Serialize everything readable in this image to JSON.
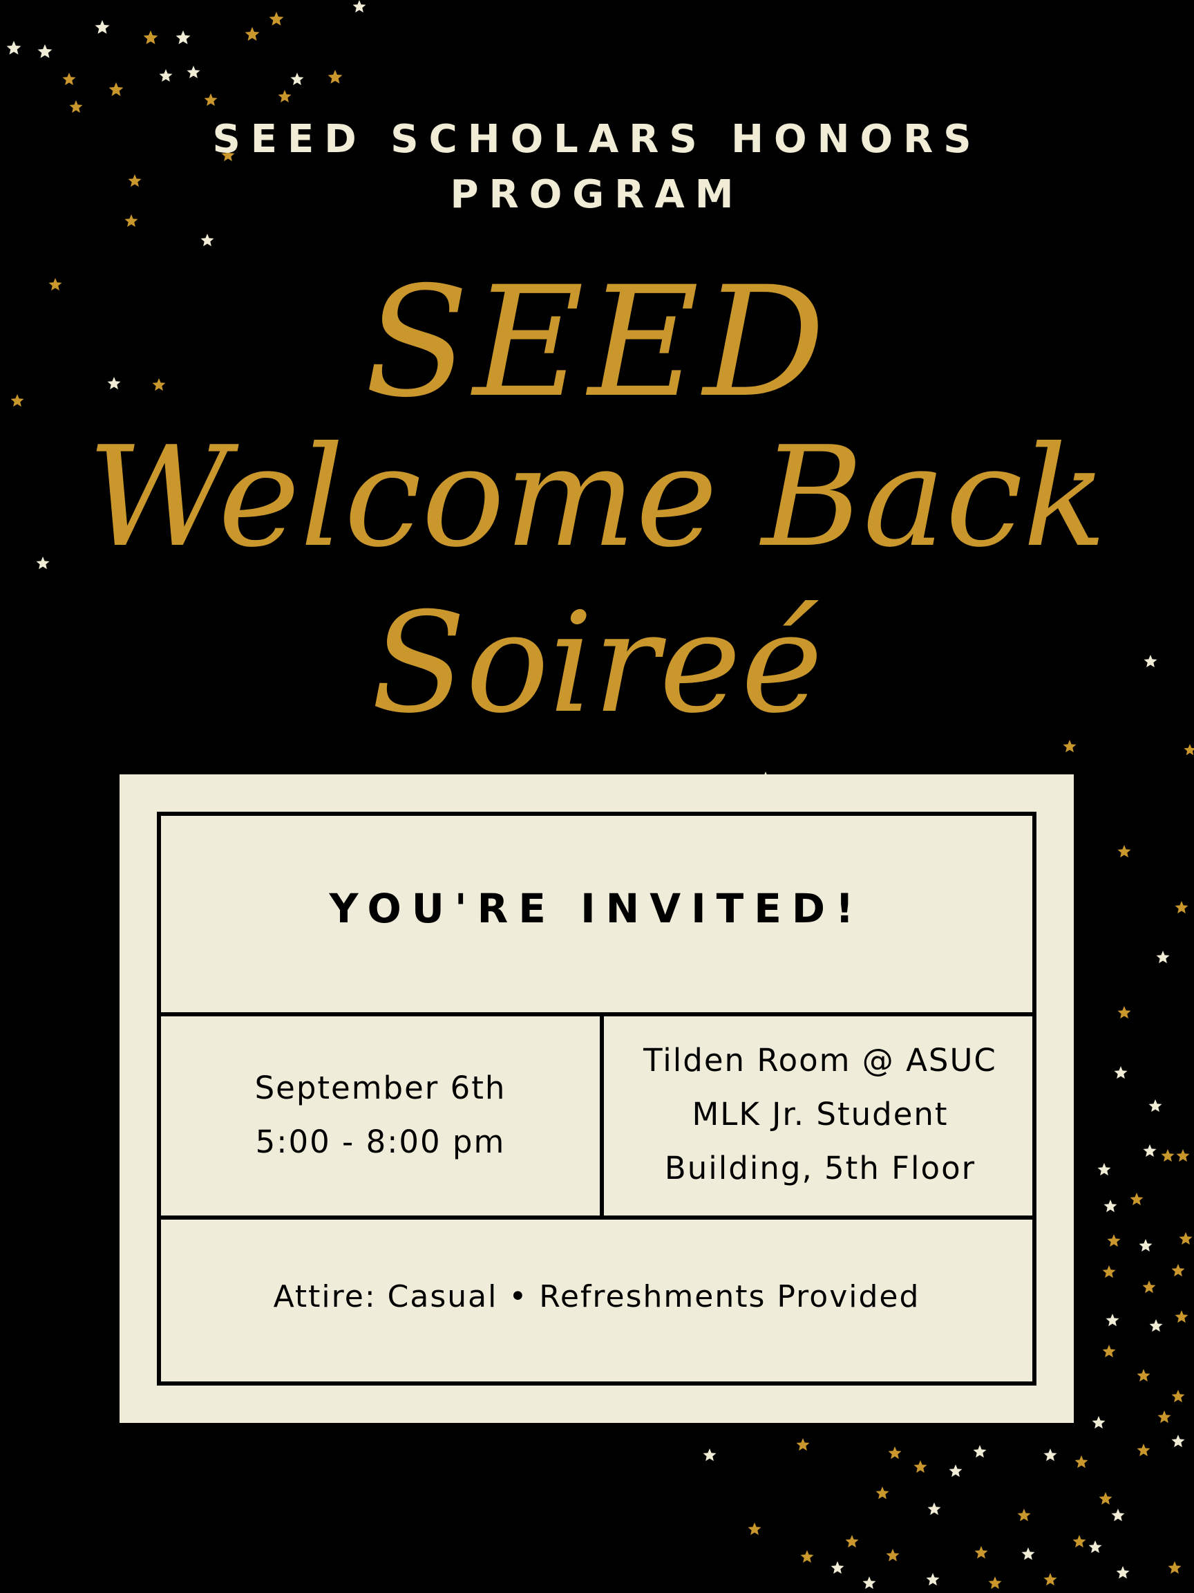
{
  "header": {
    "org_line1": "SEED SCHOLARS HONORS",
    "org_line2": "PROGRAM"
  },
  "title": {
    "line1": "SEED",
    "line2": "Welcome Back",
    "line3": "Soireé"
  },
  "invitation": {
    "heading": "YOU'RE INVITED!",
    "date": "September 6th",
    "time": "5:00 - 8:00 pm",
    "location_line1": "Tilden Room @ ASUC",
    "location_line2": "MLK Jr. Student",
    "location_line3": "Building, 5th Floor",
    "footer": "Attire: Casual • Refreshments Provided"
  },
  "colors": {
    "background": "#000000",
    "gold": "#c9972b",
    "cream": "#efecd9",
    "star_white": "#f0ecd6"
  }
}
